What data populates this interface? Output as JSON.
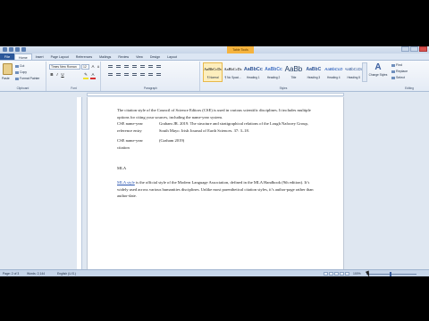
{
  "window": {
    "context_tab": "Table Tools"
  },
  "tabs": {
    "file": "File",
    "items": [
      "Home",
      "Insert",
      "Page Layout",
      "References",
      "Mailings",
      "Review",
      "View",
      "Design",
      "Layout"
    ]
  },
  "clipboard": {
    "paste": "Paste",
    "cut": "Cut",
    "copy": "Copy",
    "format_painter": "Format Painter",
    "group_label": "Clipboard"
  },
  "font": {
    "name": "Times New Roman",
    "size": "12",
    "group_label": "Font",
    "bold": "B",
    "italic": "I",
    "underline": "U"
  },
  "paragraph": {
    "group_label": "Paragraph"
  },
  "styles": {
    "group_label": "Styles",
    "items": [
      {
        "sample": "AaBbCcDc",
        "name": "¶ Normal"
      },
      {
        "sample": "AaBbCcDc",
        "name": "¶ No Spaci..."
      },
      {
        "sample": "AaBbCc",
        "name": "Heading 1"
      },
      {
        "sample": "AaBbCc",
        "name": "Heading 2"
      },
      {
        "sample": "AaBb",
        "name": "Title"
      },
      {
        "sample": "AaBbC",
        "name": "Heading 3"
      },
      {
        "sample": "AaBbCcD",
        "name": "Heading 4"
      },
      {
        "sample": "AaBbCcDc",
        "name": "Heading 5"
      }
    ],
    "change_styles": "Change Styles"
  },
  "editing": {
    "group_label": "Editing",
    "find": "Find",
    "replace": "Replace",
    "select": "Select"
  },
  "document": {
    "intro": "The citation style of the Council of Science Editors (CSE) is used in various scientific disciplines. It includes multiple options for citing your sources, including the name-year system.",
    "table": [
      [
        "CSE name-year reference entry",
        "Graham JR. 2019. The structure and stratigraphical relations of the Lough Nafooey Group, South Mayo. Irish Journal of Earth Sciences. 37: 3–18."
      ],
      [
        "CSE name-year citation",
        "(Graham 2019)"
      ]
    ],
    "mla_heading": "MLA",
    "mla_link": "MLA style",
    "mla_body": " is the official style of the Modern Language Association, defined in the MLA Handbook (9th edition). It’s widely used across various humanities disciplines. Unlike most parenthetical citation styles, it’s author-page rather than author-date."
  },
  "status": {
    "page": "Page: 2 of 3",
    "words": "Words: 2,144",
    "language": "English (U.S.)",
    "zoom": "100%"
  }
}
